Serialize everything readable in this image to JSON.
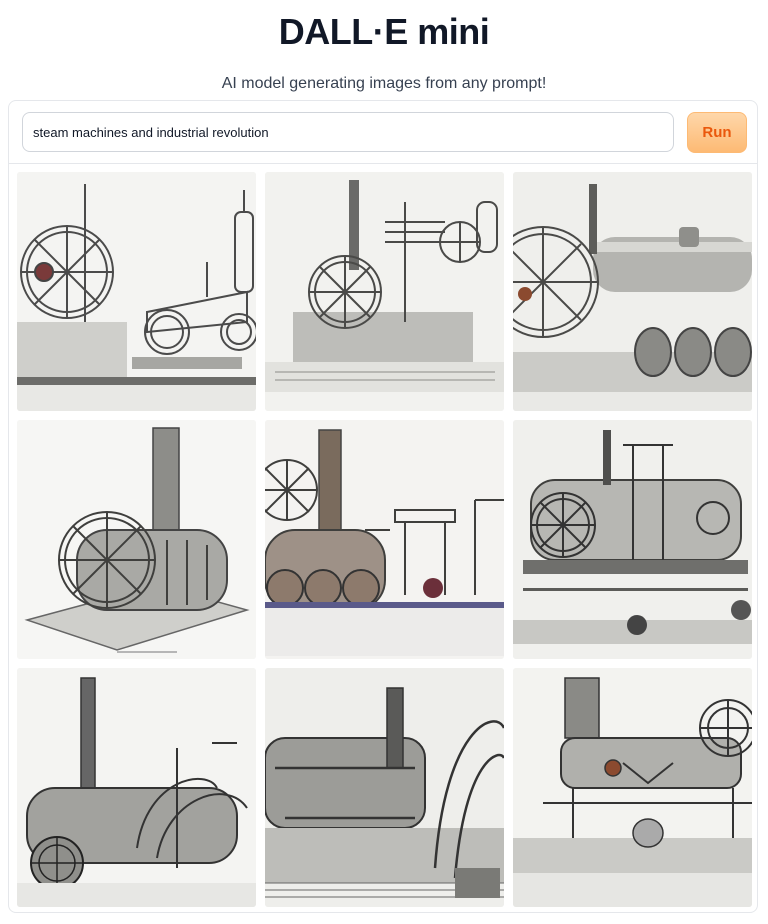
{
  "app": {
    "title": "DALL·E mini",
    "subtitle": "AI model generating images from any prompt!"
  },
  "prompt": {
    "value": "steam machines and industrial revolution",
    "placeholder": ""
  },
  "run_button": {
    "label": "Run"
  },
  "colors": {
    "accent": "#f97316",
    "button_bg": "#fed7aa",
    "border": "#e5e7eb"
  },
  "gallery": {
    "images": [
      {
        "icon": "steam-engine-image"
      },
      {
        "icon": "steam-engine-image"
      },
      {
        "icon": "steam-engine-image"
      },
      {
        "icon": "steam-engine-image"
      },
      {
        "icon": "steam-engine-image"
      },
      {
        "icon": "steam-engine-image"
      },
      {
        "icon": "steam-engine-image"
      },
      {
        "icon": "steam-engine-image"
      },
      {
        "icon": "steam-engine-image"
      }
    ]
  }
}
